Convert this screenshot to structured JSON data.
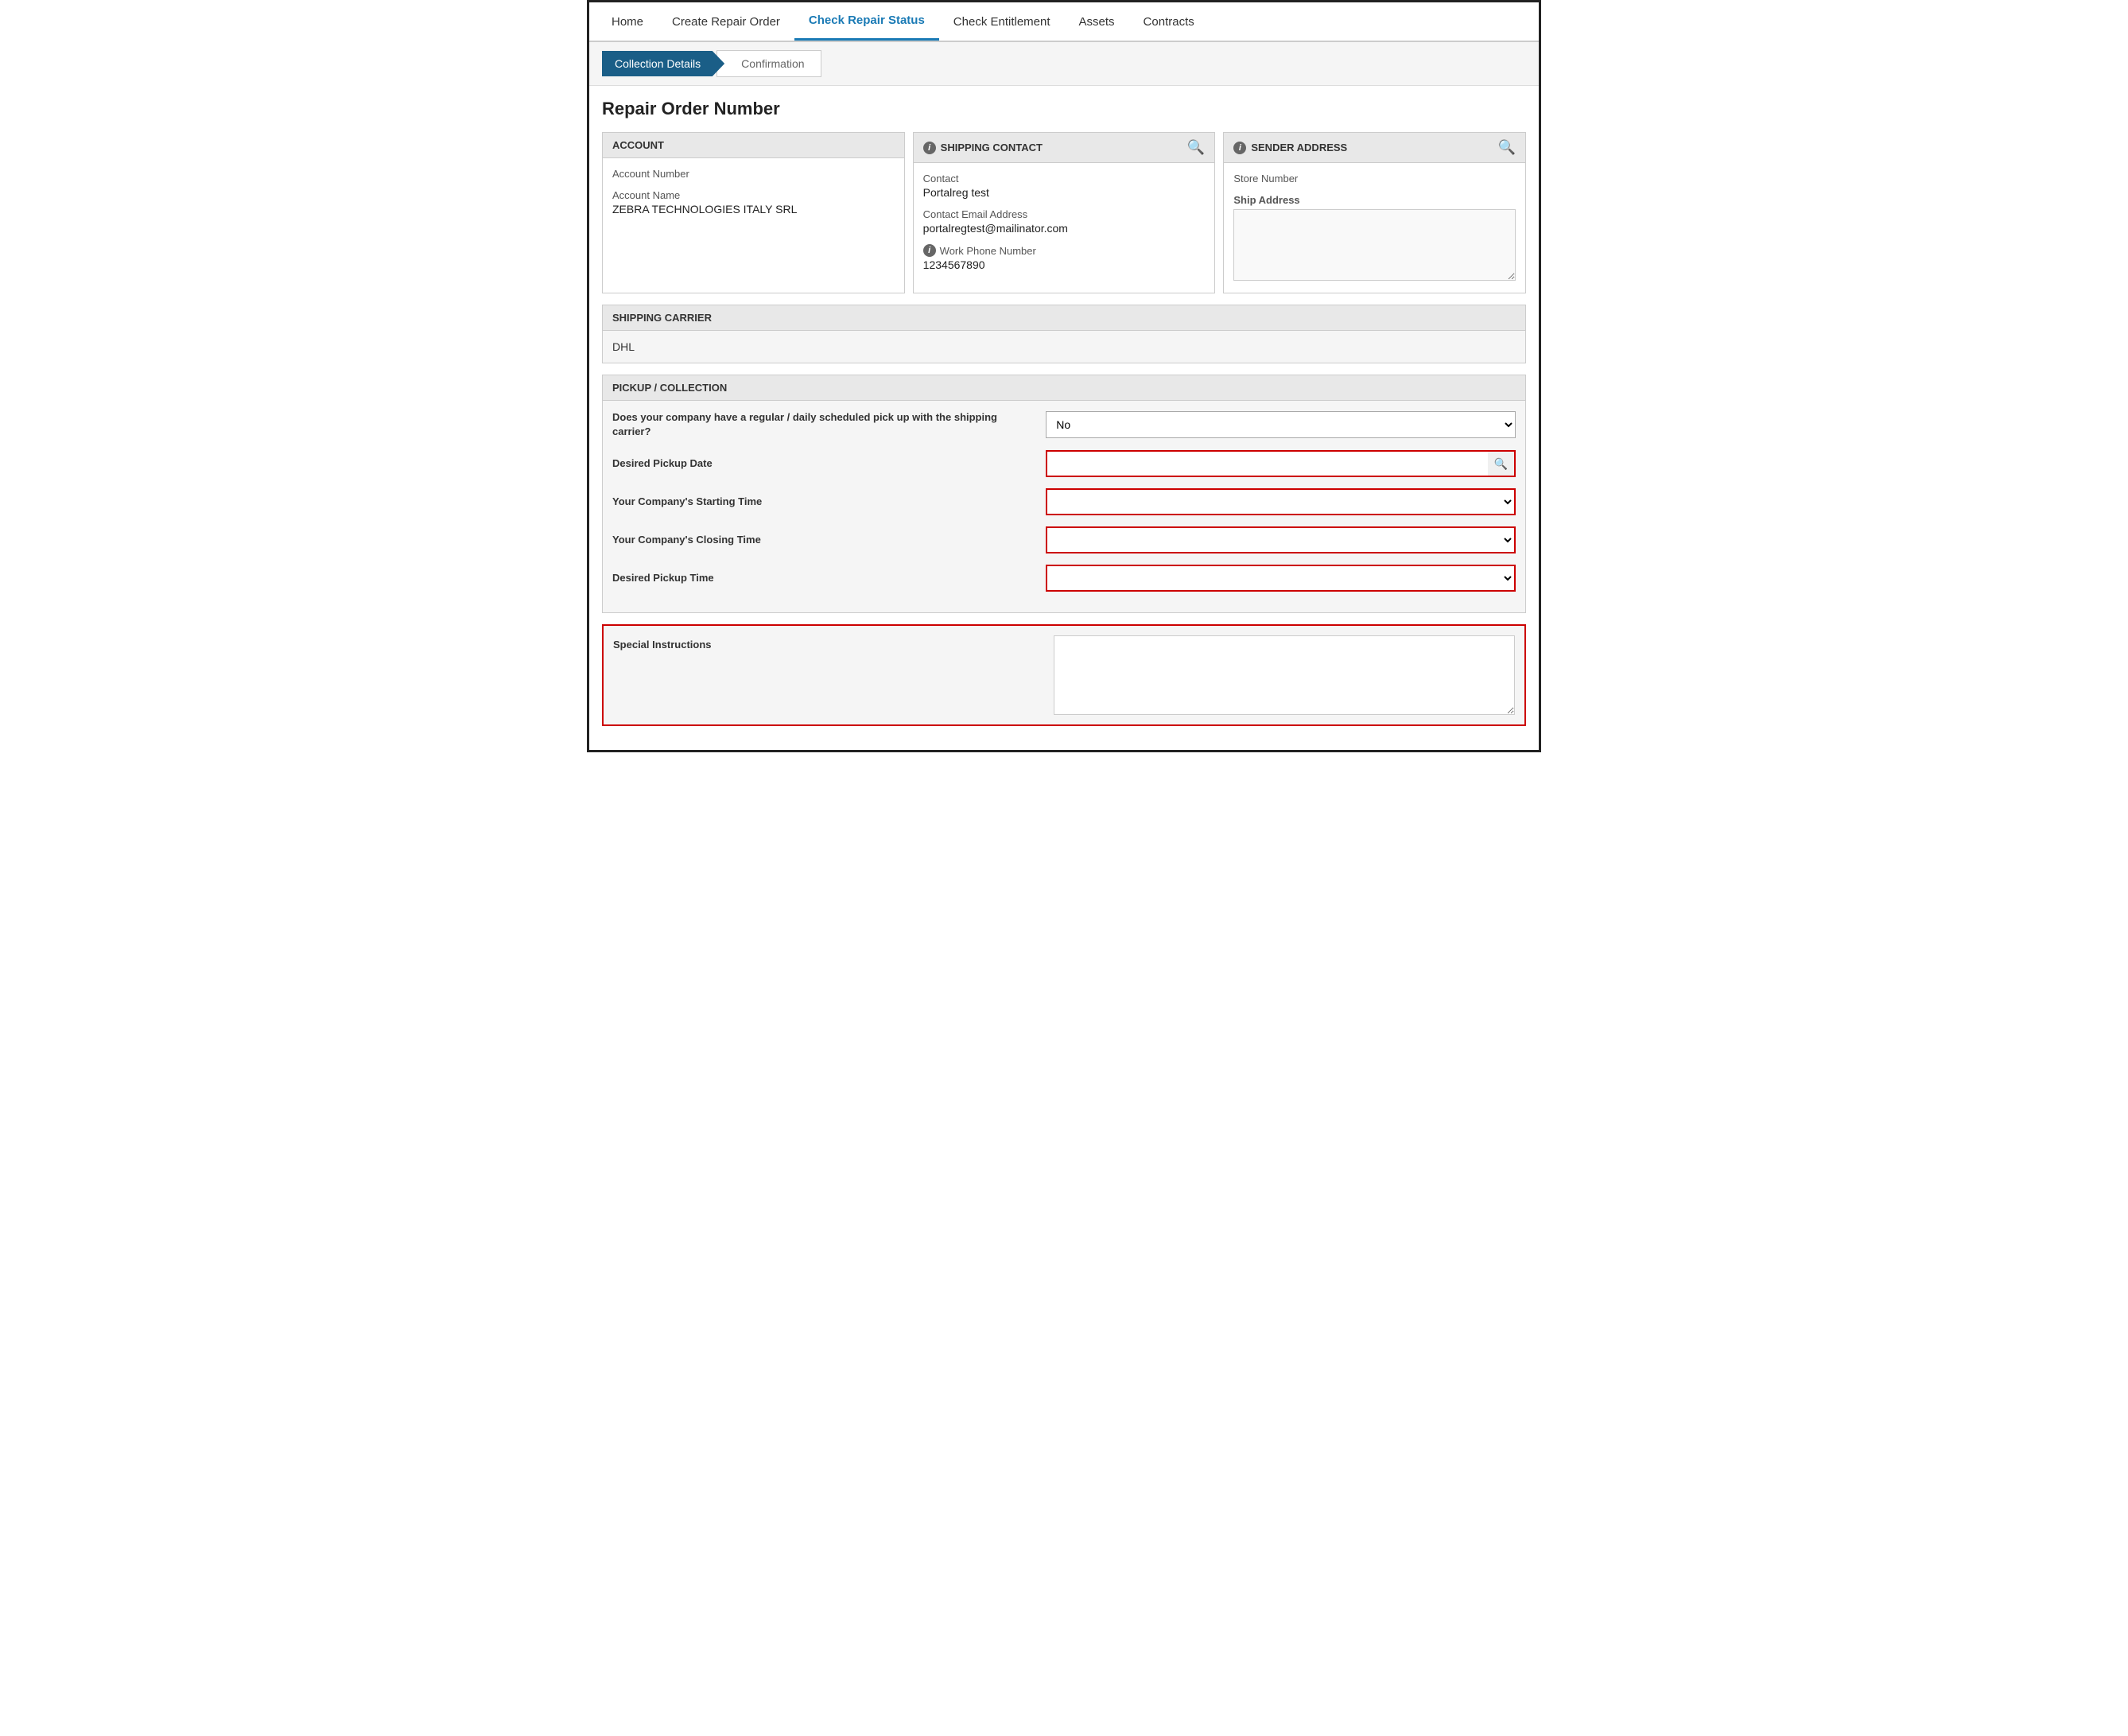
{
  "nav": {
    "items": [
      {
        "label": "Home",
        "active": false
      },
      {
        "label": "Create Repair Order",
        "active": false
      },
      {
        "label": "Check Repair Status",
        "active": true
      },
      {
        "label": "Check Entitlement",
        "active": false
      },
      {
        "label": "Assets",
        "active": false
      },
      {
        "label": "Contracts",
        "active": false
      }
    ]
  },
  "breadcrumbs": {
    "active": "Collection Details",
    "inactive": "Confirmation"
  },
  "page": {
    "title": "Repair Order Number"
  },
  "account": {
    "header": "ACCOUNT",
    "number_label": "Account Number",
    "number_value": "",
    "name_label": "Account Name",
    "name_value": "ZEBRA TECHNOLOGIES ITALY SRL"
  },
  "shipping_contact": {
    "header": "SHIPPING CONTACT",
    "contact_label": "Contact",
    "contact_value": "Portalreg test",
    "email_label": "Contact Email Address",
    "email_value": "portalregtest@mailinator.com",
    "phone_label": "Work Phone Number",
    "phone_value": "1234567890"
  },
  "sender_address": {
    "header": "SENDER ADDRESS",
    "store_number_label": "Store Number",
    "store_number_value": "",
    "ship_address_label": "Ship Address",
    "ship_address_value": ""
  },
  "shipping_carrier": {
    "header": "SHIPPING CARRIER",
    "value": "DHL"
  },
  "pickup_collection": {
    "header": "PICKUP / COLLECTION",
    "regular_pickup_label": "Does your company have a regular / daily scheduled pick up with the shipping carrier?",
    "regular_pickup_value": "No",
    "pickup_date_label": "Desired Pickup Date",
    "pickup_date_value": "",
    "starting_time_label": "Your Company's Starting Time",
    "starting_time_value": "",
    "closing_time_label": "Your Company's Closing Time",
    "closing_time_value": "",
    "desired_pickup_time_label": "Desired Pickup Time",
    "desired_pickup_time_value": ""
  },
  "special_instructions": {
    "label": "Special Instructions",
    "value": ""
  },
  "icons": {
    "info": "i",
    "search": "🔍",
    "calendar": "🔍",
    "chevron_down": "▼"
  }
}
